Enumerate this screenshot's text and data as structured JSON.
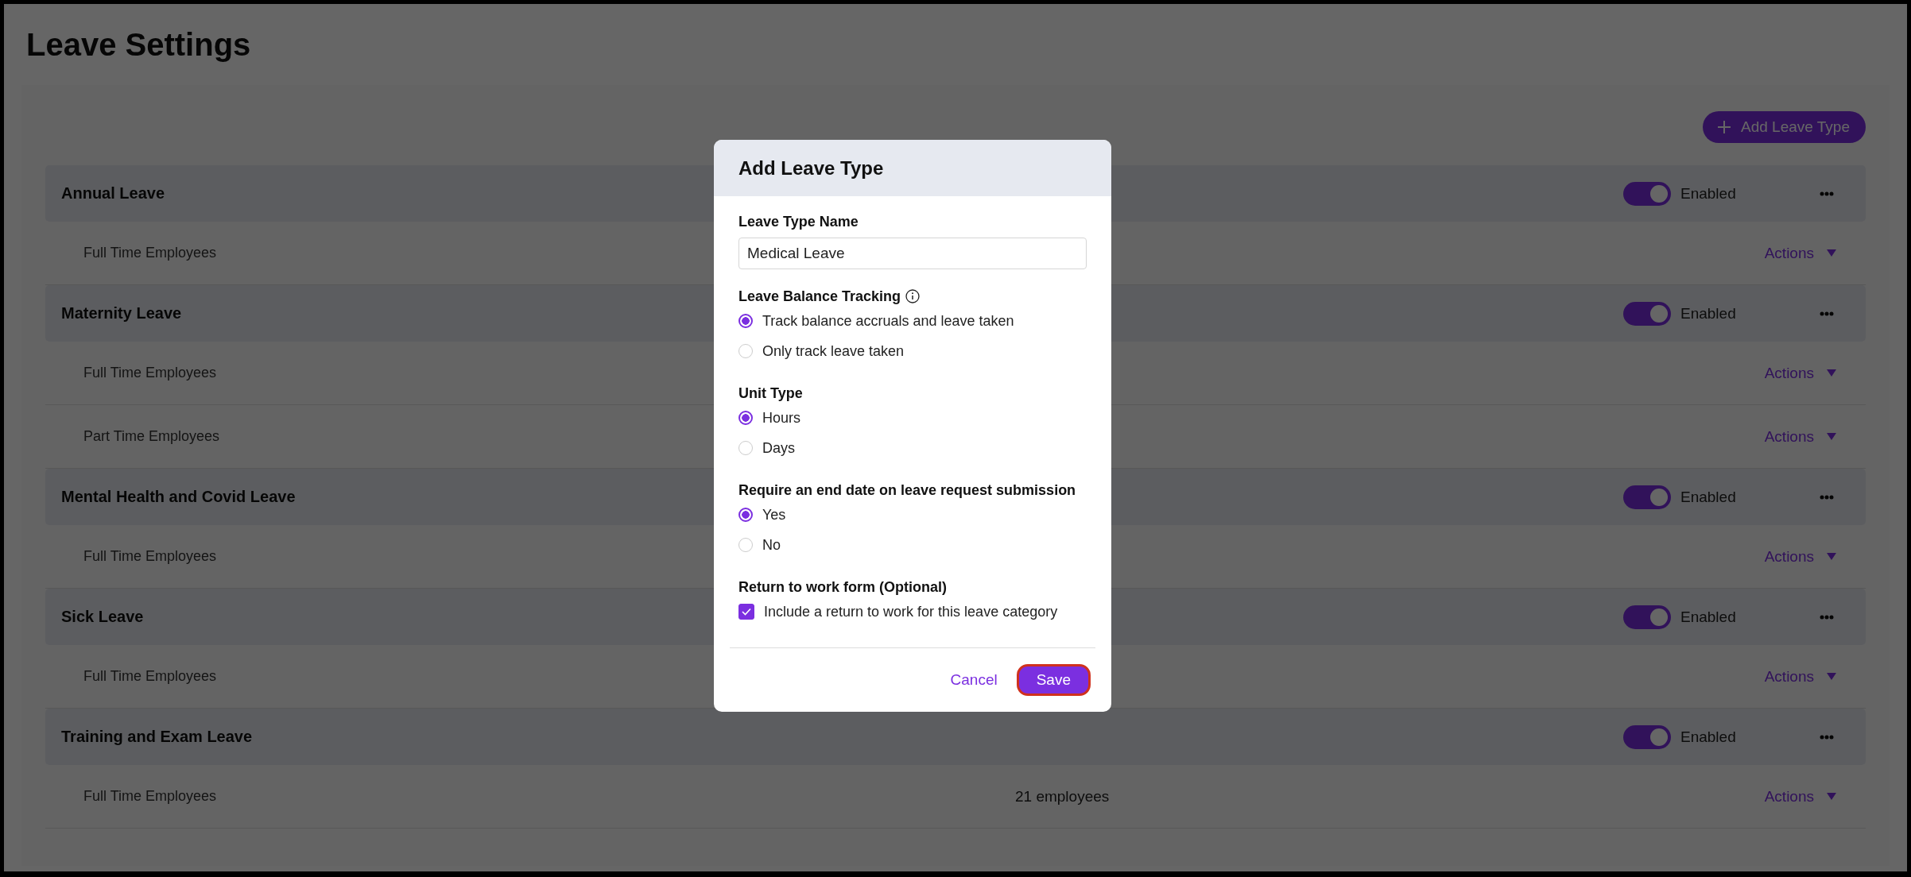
{
  "page_title": "Leave Settings",
  "add_button": "Add Leave Type",
  "leave_types": [
    {
      "name": "Annual Leave",
      "enabled": true,
      "status": "Enabled",
      "groups": [
        {
          "name": "Full Time Employees",
          "actions": "Actions"
        }
      ]
    },
    {
      "name": "Maternity Leave",
      "enabled": true,
      "status": "Enabled",
      "groups": [
        {
          "name": "Full Time Employees",
          "actions": "Actions"
        },
        {
          "name": "Part Time Employees",
          "actions": "Actions"
        }
      ]
    },
    {
      "name": "Mental Health and Covid Leave",
      "enabled": true,
      "status": "Enabled",
      "groups": [
        {
          "name": "Full Time Employees",
          "actions": "Actions"
        }
      ]
    },
    {
      "name": "Sick Leave",
      "enabled": true,
      "status": "Enabled",
      "groups": [
        {
          "name": "Full Time Employees",
          "actions": "Actions"
        }
      ]
    },
    {
      "name": "Training and Exam Leave",
      "enabled": true,
      "status": "Enabled",
      "groups": [
        {
          "name": "Full Time Employees",
          "employees": "21 employees",
          "actions": "Actions"
        }
      ]
    }
  ],
  "dialog": {
    "title": "Add Leave Type",
    "name_label": "Leave Type Name",
    "name_value": "Medical Leave",
    "sections": [
      {
        "label": "Leave Balance Tracking",
        "info": true,
        "kind": "radio",
        "options": [
          {
            "label": "Track balance accruals and leave taken",
            "selected": true
          },
          {
            "label": "Only track leave taken",
            "selected": false
          }
        ]
      },
      {
        "label": "Unit Type",
        "info": false,
        "kind": "radio",
        "options": [
          {
            "label": "Hours",
            "selected": true
          },
          {
            "label": "Days",
            "selected": false
          }
        ]
      },
      {
        "label": "Require an end date on leave request submission",
        "info": false,
        "kind": "radio",
        "options": [
          {
            "label": "Yes",
            "selected": true
          },
          {
            "label": "No",
            "selected": false
          }
        ]
      },
      {
        "label": "Return to work form (Optional)",
        "info": false,
        "kind": "checkbox",
        "options": [
          {
            "label": "Include a return to work for this leave category",
            "checked": true
          }
        ]
      }
    ],
    "cancel": "Cancel",
    "save": "Save"
  }
}
